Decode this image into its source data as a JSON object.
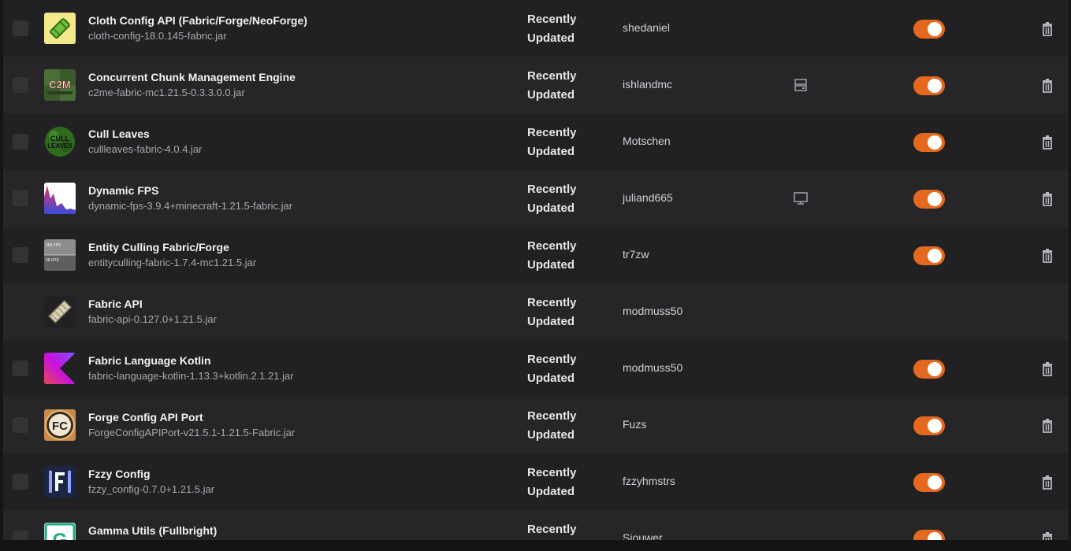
{
  "mods": [
    {
      "title": "Cloth Config API (Fabric/Forge/NeoForge)",
      "file": "cloth-config-18.0.145-fabric.jar",
      "status_line1": "Recently",
      "status_line2": "Updated",
      "author": "shedaniel",
      "env": "",
      "enabled": true,
      "deletable": true,
      "has_checkbox": true,
      "icon": "cloth-config-icon"
    },
    {
      "title": "Concurrent Chunk Management Engine",
      "file": "c2me-fabric-mc1.21.5-0.3.3.0.0.jar",
      "status_line1": "Recently",
      "status_line2": "Updated",
      "author": "ishlandmc",
      "env": "server",
      "enabled": true,
      "deletable": true,
      "has_checkbox": true,
      "icon": "c2me-icon",
      "icon_text": "C2M"
    },
    {
      "title": "Cull Leaves",
      "file": "cullleaves-fabric-4.0.4.jar",
      "status_line1": "Recently",
      "status_line2": "Updated",
      "author": "Motschen",
      "env": "",
      "enabled": true,
      "deletable": true,
      "has_checkbox": true,
      "icon": "cull-leaves-icon",
      "icon_text": "CULL"
    },
    {
      "title": "Dynamic FPS",
      "file": "dynamic-fps-3.9.4+minecraft-1.21.5-fabric.jar",
      "status_line1": "Recently",
      "status_line2": "Updated",
      "author": "juliand665",
      "env": "client",
      "enabled": true,
      "deletable": true,
      "has_checkbox": true,
      "icon": "dynamic-fps-icon"
    },
    {
      "title": "Entity Culling Fabric/Forge",
      "file": "entityculling-fabric-1.7.4-mc1.21.5.jar",
      "status_line1": "Recently",
      "status_line2": "Updated",
      "author": "tr7zw",
      "env": "",
      "enabled": true,
      "deletable": true,
      "has_checkbox": true,
      "icon": "entity-culling-icon"
    },
    {
      "title": "Fabric API",
      "file": "fabric-api-0.127.0+1.21.5.jar",
      "status_line1": "Recently",
      "status_line2": "Updated",
      "author": "modmuss50",
      "env": "",
      "enabled": null,
      "deletable": false,
      "has_checkbox": false,
      "icon": "fabric-api-icon"
    },
    {
      "title": "Fabric Language Kotlin",
      "file": "fabric-language-kotlin-1.13.3+kotlin.2.1.21.jar",
      "status_line1": "Recently",
      "status_line2": "Updated",
      "author": "modmuss50",
      "env": "",
      "enabled": true,
      "deletable": true,
      "has_checkbox": true,
      "icon": "kotlin-icon"
    },
    {
      "title": "Forge Config API Port",
      "file": "ForgeConfigAPIPort-v21.5.1-1.21.5-Fabric.jar",
      "status_line1": "Recently",
      "status_line2": "Updated",
      "author": "Fuzs",
      "env": "",
      "enabled": true,
      "deletable": true,
      "has_checkbox": true,
      "icon": "forge-config-icon",
      "icon_text": "FC"
    },
    {
      "title": "Fzzy Config",
      "file": "fzzy_config-0.7.0+1.21.5.jar",
      "status_line1": "Recently",
      "status_line2": "Updated",
      "author": "fzzyhmstrs",
      "env": "",
      "enabled": true,
      "deletable": true,
      "has_checkbox": true,
      "icon": "fzzy-config-icon"
    },
    {
      "title": "Gamma Utils (Fullbright)",
      "file": "",
      "status_line1": "Recently",
      "status_line2": "",
      "author": "Sjouwer",
      "env": "",
      "enabled": true,
      "deletable": true,
      "has_checkbox": true,
      "icon": "gamma-utils-icon",
      "icon_text": "G"
    }
  ],
  "colors": {
    "toggle_on": "#e4681d",
    "row_alt": "#262628",
    "row_base": "#212123"
  }
}
